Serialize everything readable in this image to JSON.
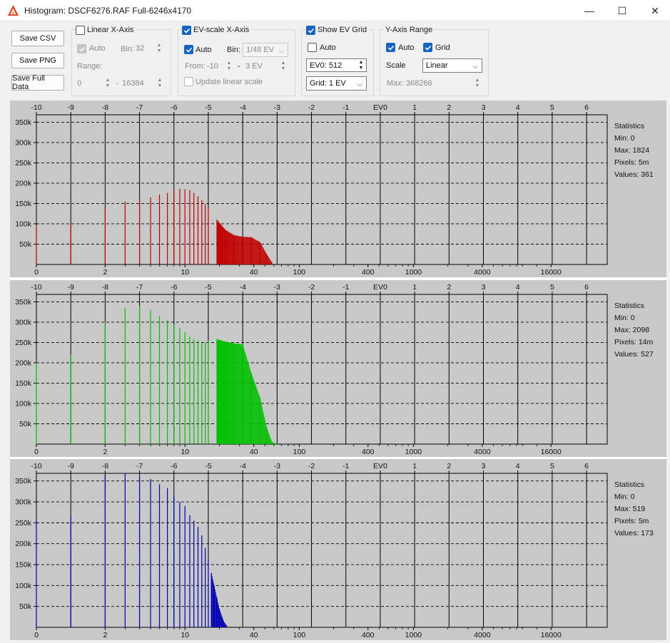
{
  "window": {
    "title": "Histogram: DSCF6276.RAF Full-6246x4170",
    "controls": {
      "minimize": "—",
      "maximize": "☐",
      "close": "✕"
    }
  },
  "buttons": {
    "save_csv": "Save CSV",
    "save_png": "Save PNG",
    "save_full_data": "Save Full Data"
  },
  "linear_x_axis": {
    "label": "Linear X-Axis",
    "checked": false,
    "auto_label": "Auto",
    "auto_checked": true,
    "bin_label": "Bin:",
    "bin_value": "32",
    "range_label": "Range:",
    "range_from": "0",
    "range_dash": "-",
    "range_to": "16384"
  },
  "ev_scale_x_axis": {
    "label": "EV-scale X-Axis",
    "checked": true,
    "auto_label": "Auto",
    "auto_checked": true,
    "bin_label": "Bin:",
    "bin_value": "1/48 EV",
    "from_label": "From:",
    "from_value": "-10",
    "dash": "-",
    "to_value": "3 EV",
    "update_label": "Update linear scale",
    "update_checked": false
  },
  "ev_grid": {
    "label": "Show EV Grid",
    "checked": true,
    "auto_label": "Auto",
    "auto_checked": false,
    "ev0_value": "EV0: 512",
    "grid_value": "Grid: 1 EV"
  },
  "y_axis_range": {
    "label": "Y-Axis Range",
    "auto_label": "Auto",
    "auto_checked": true,
    "grid_label": "Grid",
    "grid_checked": true,
    "scale_label": "Scale",
    "scale_value": "Linear",
    "max_value": "Max: 368266"
  },
  "colors": {
    "red": "#c00000",
    "green": "#00c000",
    "blue": "#0000b0",
    "panel_bg": "#c8c8c8",
    "accent": "#1565c0"
  },
  "chart_data": [
    {
      "type": "bar",
      "channel": "red",
      "ev_ticks": [
        "-10",
        "-9",
        "-8",
        "-7",
        "-6",
        "-5",
        "-4",
        "-3",
        "-2",
        "-1",
        "EV0",
        "1",
        "2",
        "3",
        "4",
        "5",
        "6"
      ],
      "value_ticks": [
        "0",
        "2",
        "10",
        "40",
        "100",
        "400",
        "1000",
        "4000",
        "16000"
      ],
      "y_ticks": [
        "350k",
        "300k",
        "250k",
        "200k",
        "150k",
        "100k",
        "50k"
      ],
      "ylim": [
        0,
        368266
      ],
      "series": [
        {
          "x": [
            -10,
            -9,
            -8,
            -7.42,
            -7,
            -6.68,
            -6.42,
            -6.19,
            -6,
            -5.83,
            -5.68,
            -5.54,
            -5.42,
            -5.3,
            -5.19,
            -5.09,
            -5,
            -4.75,
            -4.5,
            -4.25,
            -4,
            -3.75,
            -3.5,
            -3.3,
            -3.15
          ],
          "y": [
            95000,
            98000,
            140000,
            155000,
            160000,
            165000,
            172000,
            176000,
            182000,
            186000,
            185000,
            183000,
            176000,
            168000,
            158000,
            148000,
            138000,
            110000,
            85000,
            72000,
            68000,
            67000,
            55000,
            25000,
            5000
          ]
        }
      ],
      "statistics": {
        "title": "Statistics",
        "min": "Min: 0",
        "max": "Max: 1824",
        "pixels": "Pixels: 5m",
        "values": "Values: 361"
      }
    },
    {
      "type": "bar",
      "channel": "green",
      "ev_ticks": [
        "-10",
        "-9",
        "-8",
        "-7",
        "-6",
        "-5",
        "-4",
        "-3",
        "-2",
        "-1",
        "EV0",
        "1",
        "2",
        "3",
        "4",
        "5",
        "6"
      ],
      "value_ticks": [
        "0",
        "2",
        "10",
        "40",
        "100",
        "400",
        "1000",
        "4000",
        "16000"
      ],
      "y_ticks": [
        "350k",
        "300k",
        "250k",
        "200k",
        "150k",
        "100k",
        "50k"
      ],
      "ylim": [
        0,
        368266
      ],
      "series": [
        {
          "x": [
            -10,
            -9,
            -8,
            -7.42,
            -7,
            -6.68,
            -6.42,
            -6.19,
            -6,
            -5.83,
            -5.68,
            -5.54,
            -5.42,
            -5.3,
            -5.19,
            -5.09,
            -5,
            -4.75,
            -4.5,
            -4.25,
            -4,
            -3.75,
            -3.5,
            -3.3,
            -3.15,
            -3.0
          ],
          "y": [
            200000,
            220000,
            300000,
            335000,
            340000,
            330000,
            315000,
            305000,
            295000,
            285000,
            275000,
            265000,
            258000,
            255000,
            250000,
            250000,
            255000,
            258000,
            252000,
            248000,
            245000,
            175000,
            115000,
            40000,
            5000,
            1000
          ]
        }
      ],
      "statistics": {
        "title": "Statistics",
        "min": "Min: 0",
        "max": "Max: 2098",
        "pixels": "Pixels: 14m",
        "values": "Values: 527"
      }
    },
    {
      "type": "bar",
      "channel": "blue",
      "ev_ticks": [
        "-10",
        "-9",
        "-8",
        "-7",
        "-6",
        "-5",
        "-4",
        "-3",
        "-2",
        "-1",
        "EV0",
        "1",
        "2",
        "3",
        "4",
        "5",
        "6"
      ],
      "value_ticks": [
        "0",
        "2",
        "10",
        "40",
        "100",
        "400",
        "1000",
        "4000",
        "16000"
      ],
      "y_ticks": [
        "350k",
        "300k",
        "250k",
        "200k",
        "150k",
        "100k",
        "50k"
      ],
      "ylim": [
        0,
        368266
      ],
      "series": [
        {
          "x": [
            -10,
            -9,
            -8,
            -7.42,
            -7,
            -6.68,
            -6.42,
            -6.19,
            -6,
            -5.83,
            -5.68,
            -5.54,
            -5.42,
            -5.3,
            -5.19,
            -5.09,
            -5,
            -4.91,
            -4.83,
            -4.75,
            -4.68,
            -4.6,
            -4.54,
            -4.47
          ],
          "y": [
            255000,
            265000,
            365000,
            368000,
            358000,
            355000,
            342000,
            333000,
            315000,
            300000,
            290000,
            268000,
            255000,
            240000,
            220000,
            190000,
            160000,
            130000,
            100000,
            70000,
            45000,
            25000,
            12000,
            5000
          ]
        }
      ],
      "statistics": {
        "title": "Statistics",
        "min": "Min: 0",
        "max": "Max: 519",
        "pixels": "Pixels: 5m",
        "values": "Values: 173"
      }
    }
  ]
}
